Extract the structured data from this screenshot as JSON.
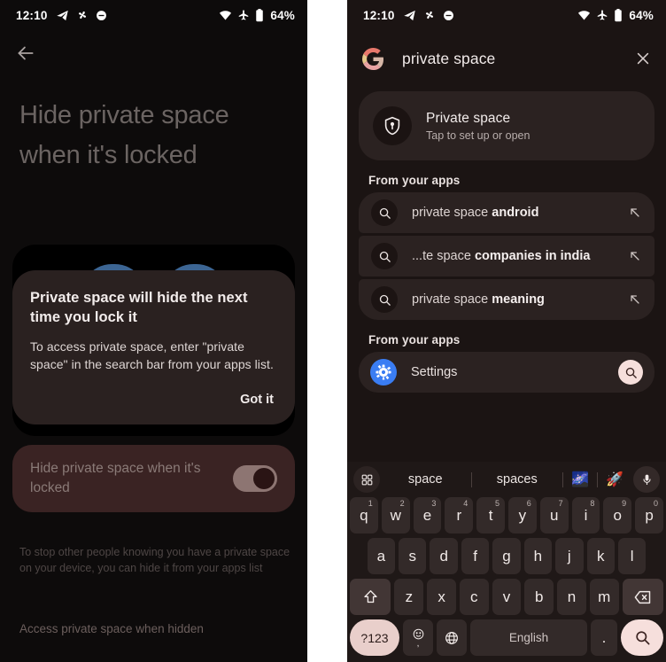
{
  "status_bar": {
    "time": "12:10",
    "battery": "64%",
    "left_icons": [
      "telegram-icon",
      "pinwheel-icon",
      "do-not-disturb-icon"
    ],
    "right_icons": [
      "wifi-icon",
      "airplane-mode-icon",
      "battery-icon"
    ]
  },
  "left_screen": {
    "back_icon": "back-arrow-icon",
    "title": "Hide private space when it's locked",
    "dialog": {
      "title": "Private space will hide the next time you lock it",
      "body": "To access private space, enter \"private space\" in the search bar from your apps list.",
      "action": "Got it"
    },
    "toggle": {
      "label": "Hide private space when it's locked",
      "state": "on"
    },
    "footer_note": "To stop other people knowing you have a private space on your device, you can hide it from your apps list",
    "footer_link": "Access private space when hidden"
  },
  "right_screen": {
    "search": {
      "logo": "google-g-icon",
      "query": "private space",
      "clear_icon": "close-icon"
    },
    "private_space_card": {
      "icon": "shield-lock-icon",
      "title": "Private space",
      "subtitle": "Tap to set up or open"
    },
    "section_headers": {
      "first": "From your apps",
      "second": "From your apps"
    },
    "suggestions": [
      {
        "icon": "search-icon",
        "prefix": "private space ",
        "bold": "android",
        "trailing_icon": "arrow-up-left-icon"
      },
      {
        "icon": "search-icon",
        "prefix": "...te space ",
        "bold": "companies in india",
        "trailing_icon": "arrow-up-left-icon"
      },
      {
        "icon": "search-icon",
        "prefix": "private space ",
        "bold": "meaning",
        "trailing_icon": "arrow-up-left-icon"
      }
    ],
    "app_results": [
      {
        "icon": "settings-gear-icon",
        "name": "Settings",
        "action_icon": "search-icon"
      }
    ],
    "keyboard": {
      "strip": {
        "grid_icon": "keyboard-grid-icon",
        "suggestion_1": "space",
        "suggestion_2": "spaces",
        "emoji_1": "🌌",
        "emoji_2": "🚀",
        "mic_icon": "microphone-icon"
      },
      "row1": [
        {
          "key": "q",
          "num": "1"
        },
        {
          "key": "w",
          "num": "2"
        },
        {
          "key": "e",
          "num": "3"
        },
        {
          "key": "r",
          "num": "4"
        },
        {
          "key": "t",
          "num": "5"
        },
        {
          "key": "y",
          "num": "6"
        },
        {
          "key": "u",
          "num": "7"
        },
        {
          "key": "i",
          "num": "8"
        },
        {
          "key": "o",
          "num": "9"
        },
        {
          "key": "p",
          "num": "0"
        }
      ],
      "row2": [
        "a",
        "s",
        "d",
        "f",
        "g",
        "h",
        "j",
        "k",
        "l"
      ],
      "row3": [
        "z",
        "x",
        "c",
        "v",
        "b",
        "n",
        "m"
      ],
      "shift_icon": "shift-icon",
      "backspace_icon": "backspace-icon",
      "numeric_key": "?123",
      "emoji_key_icon": "emoji-icon",
      "emoji_key_sub": ",",
      "globe_icon": "globe-icon",
      "space_key": "English",
      "period_key": ".",
      "search_key_icon": "search-icon"
    }
  }
}
